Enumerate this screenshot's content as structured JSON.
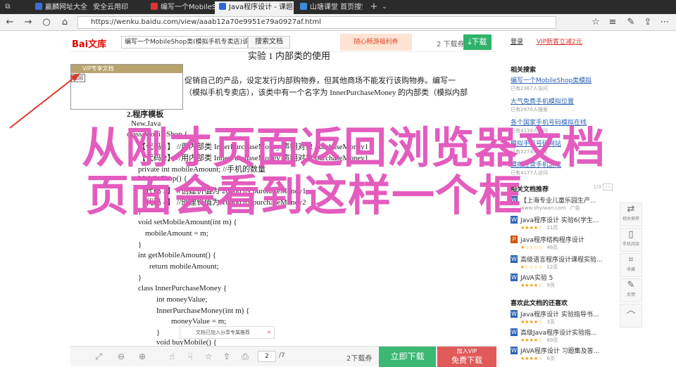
{
  "browser": {
    "tabs": [
      {
        "label": "赢麟网址大全",
        "fav_color": "#3a6fd6"
      },
      {
        "label": "安全云用印",
        "fav_color": "#5a5a5a"
      },
      {
        "label": "编写一个MobileShop类(模拟",
        "fav_color": "#d33"
      },
      {
        "label": "Java程序设计 - 课题 (",
        "fav_color": "#2b69d8"
      },
      {
        "label": "山塘课堂 首页搜索",
        "fav_color": "#3a8be0"
      }
    ],
    "address": "https://wenku.baidu.com/view/aaab12a70e9951e79a0927af.html"
  },
  "header": {
    "logo": "Bai文库",
    "search_value": "编写一个MobileShop类(模拟手机专卖店)该类有一个价格",
    "search_button": "搜索文档",
    "banner": "随心畅游福利券",
    "download_count": "2 下载券",
    "download_button": "下载"
  },
  "doc": {
    "title_line": "实验 1 内部类的使用",
    "paragraph_lines": [
      "促销自己的产品，设定发行内部购物券，但其他商场不能发行该购物券。编写一",
      "（模拟手机专卖店），该类中有一个名字为 InnerPurchaseMoney 的内部类（模拟内部"
    ],
    "section_title": "2.程序模板",
    "code_lines": [
      "New.Java",
      "class MobileShop {",
      "【代码 1】 //用内部类 InnerPurchaseMoney 声明对象 purchaseMoney1",
      "【代码 2】 //用内部类 InnerPurchaseMoney 声明对象 purchaseMoney1",
      "private int mobileAmount; //手机的数量",
      "MobileShop() {",
      "【代码 3】 //创建价值为 20000 的 purchaseMoney1",
      "【代码 4】 //创建价值为 10000 的 purchaseMoney2",
      "}",
      "void setMobileAmount(int m) {",
      "mobileAmount = m;",
      "}",
      "int getMobileAmount() {",
      "return mobileAmount;",
      "}",
      "class InnerPurchaseMoney {",
      "int moneyValue;",
      "InnerPurchaseMoney(int m) {",
      "moneyValue = m;",
      "}",
      "void buyMobile() {"
    ],
    "vip_popup_header": "VIP专享文档",
    "vip_popup_tag": "返回",
    "share_text": "文档已加入分享专属推荐"
  },
  "bottom_bar": {
    "page_current": "2",
    "page_total": "/7",
    "download_count": "2下载券",
    "instant_download": "立即下载",
    "vip_small": "加入VIP",
    "vip_big": "免费下载"
  },
  "sidebar": {
    "top_link_a": "登录",
    "top_link_b": "VIP新客立减2元",
    "related_search_title": "相关搜索",
    "related_search": [
      {
        "link": "编写一个MobileShop类模拟",
        "meta": "已有2367人访问"
      },
      {
        "link": "大气免费手机模拟位置",
        "meta": "已有2970人搜索"
      },
      {
        "link": "各个国家手机号码模拟在线",
        "meta": "已有4139人访问"
      },
      {
        "link": "模拟手机号码网站",
        "meta": "已有3274人搜索"
      },
      {
        "link": "模拟经营手机游戏",
        "meta": "已有4177人访问"
      }
    ],
    "recommend_title": "相关文档推荐",
    "recommend_nav": "1/3",
    "recommend": [
      {
        "title": "【上海专业儿童乐园生产...",
        "meta_a": "www.shyiwan.com",
        "meta_b": "广告",
        "icon": "W",
        "icon_color": "#2d64b3"
      },
      {
        "title": "Java程序设计 实验6(学生...",
        "meta_a": "★★★★☆",
        "meta_b": "21页",
        "icon": "W",
        "icon_color": "#2d64b3"
      },
      {
        "title": "java程序结构程序设计",
        "meta_a": "★☆☆☆☆",
        "meta_b": "46页",
        "icon": "P",
        "icon_color": "#d35400"
      },
      {
        "title": "高级语言程序设计课程实验...",
        "meta_a": "★☆☆☆☆",
        "meta_b": "12页",
        "icon": "W",
        "icon_color": "#2d64b3"
      },
      {
        "title": "JAVA实验   5",
        "meta_a": "★★★★☆",
        "meta_b": "9页",
        "icon": "W",
        "icon_color": "#2d64b3"
      }
    ],
    "also_like_title": "喜欢此文档的还喜欢",
    "also_like": [
      {
        "title": "Java程序设计 实验指导书...",
        "meta_a": "★★★★☆",
        "meta_b": "3页",
        "icon": "W",
        "icon_color": "#2d64b3"
      },
      {
        "title": "高级Java程序设计实验指...",
        "meta_a": "★★★★☆",
        "meta_b": "69页",
        "icon": "W",
        "icon_color": "#2d64b3"
      },
      {
        "title": "JAVA程序设计 习题集及答...",
        "meta_a": "★★★★☆",
        "meta_b": "6页",
        "icon": "W",
        "icon_color": "#2d64b3"
      }
    ]
  },
  "float_tools": [
    {
      "glyph": "⇄",
      "label": "相关推荐"
    },
    {
      "glyph": "▯",
      "label": "手机阅读"
    },
    {
      "glyph": "⌗",
      "label": "收藏"
    },
    {
      "glyph": "✎",
      "label": "反馈"
    },
    {
      "glyph": "︿",
      "label": ""
    }
  ],
  "overlay": {
    "line1": "从刚才页面返回浏览器文档",
    "line2": "页面会看到这样一个框",
    "color": "#e357bc",
    "arrow_color": "#e0362c"
  }
}
